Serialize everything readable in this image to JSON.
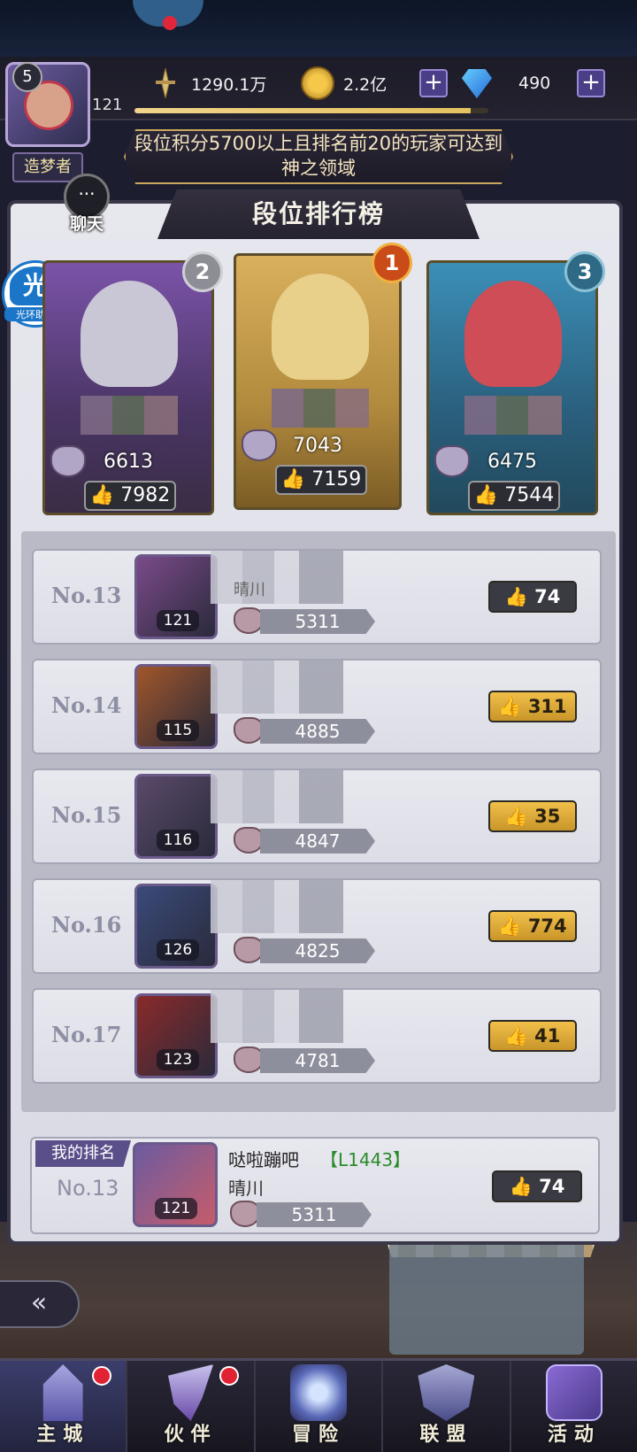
{
  "header": {
    "avatar_level": "5",
    "player_level": "121",
    "title_badge": "造梦者",
    "power": "1290.1万",
    "gold": "2.2亿",
    "gems": "490",
    "plus": "+",
    "exp_progress_percent": 95
  },
  "banner": {
    "text": "段位积分5700以上且排名前20的玩家可达到神之领域"
  },
  "chat": {
    "icon_glyph": "···",
    "label": "聊天"
  },
  "helper": {
    "main": "光",
    "sub": "光环助手"
  },
  "leaderboard": {
    "title": "段位排行榜",
    "top3": [
      {
        "medal": "2",
        "score": "6613",
        "likes": "7982",
        "color": "#7b53a8"
      },
      {
        "medal": "1",
        "score": "7043",
        "likes": "7159",
        "color": "#d9b05c"
      },
      {
        "medal": "3",
        "score": "6475",
        "likes": "7544",
        "color": "#3c8fb8"
      }
    ],
    "rows": [
      {
        "no": "No.13",
        "level": "121",
        "points": "5311",
        "likes": "74",
        "like_style": "gray",
        "portrait_color": "#7a4a8a"
      },
      {
        "no": "No.14",
        "level": "115",
        "points": "4885",
        "likes": "311",
        "like_style": "gold",
        "portrait_color": "#a0562a"
      },
      {
        "no": "No.15",
        "level": "116",
        "points": "4847",
        "likes": "35",
        "like_style": "gold",
        "portrait_color": "#5a4a6a"
      },
      {
        "no": "No.16",
        "level": "126",
        "points": "4825",
        "likes": "774",
        "like_style": "gold",
        "portrait_color": "#3a4a7a"
      },
      {
        "no": "No.17",
        "level": "123",
        "points": "4781",
        "likes": "41",
        "like_style": "gold",
        "portrait_color": "#8a2a2a"
      }
    ],
    "row13_guild": "晴川"
  },
  "my_rank": {
    "tag": "我的排名",
    "no": "No.13",
    "level": "121",
    "name": "哒啦蹦吧",
    "code": "【L1443】",
    "guild": "晴川",
    "points": "5311",
    "likes": "74"
  },
  "like_icon": "👍",
  "back_glyph": "«",
  "nav": [
    {
      "label": "主城",
      "icon": "castle-icon",
      "badge": true
    },
    {
      "label": "伙伴",
      "icon": "wizard-hat-icon",
      "badge": true
    },
    {
      "label": "冒险",
      "icon": "compass-icon",
      "badge": false
    },
    {
      "label": "联盟",
      "icon": "shield-icon",
      "badge": false
    },
    {
      "label": "活动",
      "icon": "cards-icon",
      "badge": false
    }
  ]
}
